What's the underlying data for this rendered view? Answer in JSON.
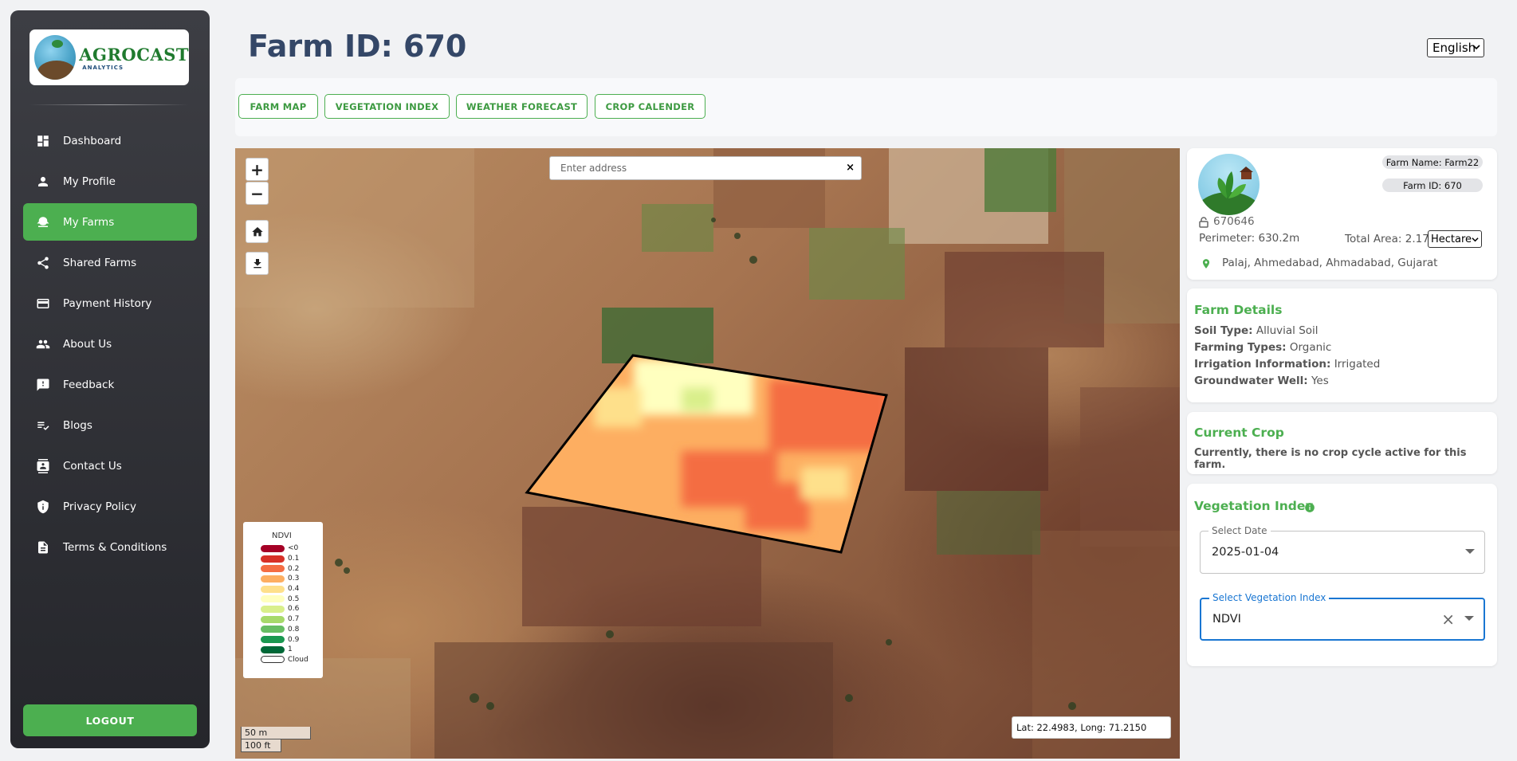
{
  "sidebar": {
    "logo": {
      "main": "AGROCAST",
      "sub": "ANALYTICS"
    },
    "items": [
      {
        "label": "Dashboard",
        "icon": "dashboard-icon",
        "active": false
      },
      {
        "label": "My Profile",
        "icon": "person-icon",
        "active": false
      },
      {
        "label": "My Farms",
        "icon": "farm-icon",
        "active": true
      },
      {
        "label": "Shared Farms",
        "icon": "share-icon",
        "active": false
      },
      {
        "label": "Payment History",
        "icon": "credit-card-icon",
        "active": false
      },
      {
        "label": "About Us",
        "icon": "people-icon",
        "active": false
      },
      {
        "label": "Feedback",
        "icon": "feedback-icon",
        "active": false
      },
      {
        "label": "Blogs",
        "icon": "blog-icon",
        "active": false
      },
      {
        "label": "Contact Us",
        "icon": "contact-icon",
        "active": false
      },
      {
        "label": "Privacy Policy",
        "icon": "shield-icon",
        "active": false
      },
      {
        "label": "Terms & Conditions",
        "icon": "document-icon",
        "active": false
      }
    ],
    "logout": "LOGOUT"
  },
  "header": {
    "title": "Farm ID: 670",
    "language": "English"
  },
  "tabs": [
    "FARM MAP",
    "VEGETATION INDEX",
    "WEATHER FORECAST",
    "CROP CALENDER"
  ],
  "map": {
    "search_placeholder": "Enter address",
    "search_clear": "×",
    "zoom_in": "+",
    "zoom_out": "−",
    "legend": {
      "title": "NDVI",
      "entries": [
        {
          "label": "<0",
          "color": "#a50026"
        },
        {
          "label": "0.1",
          "color": "#d73027"
        },
        {
          "label": "0.2",
          "color": "#f46d43"
        },
        {
          "label": "0.3",
          "color": "#fdae61"
        },
        {
          "label": "0.4",
          "color": "#fee08b"
        },
        {
          "label": "0.5",
          "color": "#ffffbf"
        },
        {
          "label": "0.6",
          "color": "#d9ef8b"
        },
        {
          "label": "0.7",
          "color": "#a6d96a"
        },
        {
          "label": "0.8",
          "color": "#66bd63"
        },
        {
          "label": "0.9",
          "color": "#1a9850"
        },
        {
          "label": "1",
          "color": "#006837"
        },
        {
          "label": "Cloud",
          "color": "#ffffff"
        }
      ]
    },
    "scale_m": "50 m",
    "scale_ft": "100 ft",
    "coords": "Lat: 22.4983, Long: 71.2150"
  },
  "farm_card": {
    "name_badge": "Farm Name: Farm22",
    "id_badge": "Farm ID: 670",
    "code": "670646",
    "perimeter": "Perimeter: 630.2m",
    "total_area": "Total Area: 2.17",
    "unit": "Hectare",
    "location": "Palaj, Ahmedabad, Ahmadabad, Gujarat"
  },
  "farm_details": {
    "title": "Farm Details",
    "rows": [
      {
        "key": "Soil Type:",
        "value": "Alluvial Soil"
      },
      {
        "key": "Farming Types:",
        "value": "Organic"
      },
      {
        "key": "Irrigation Information:",
        "value": "Irrigated"
      },
      {
        "key": "Groundwater Well:",
        "value": "Yes"
      }
    ]
  },
  "current_crop": {
    "title": "Current Crop",
    "message": "Currently, there is no crop cycle active for this farm."
  },
  "vegetation": {
    "title": "Vegetation Index",
    "date_label": "Select Date",
    "date_value": "2025-01-04",
    "index_label": "Select Vegetation Index",
    "index_value": "NDVI",
    "clear": "×"
  },
  "colors": {
    "accent": "#4caf50",
    "title": "#344767",
    "focus": "#1976d2"
  }
}
